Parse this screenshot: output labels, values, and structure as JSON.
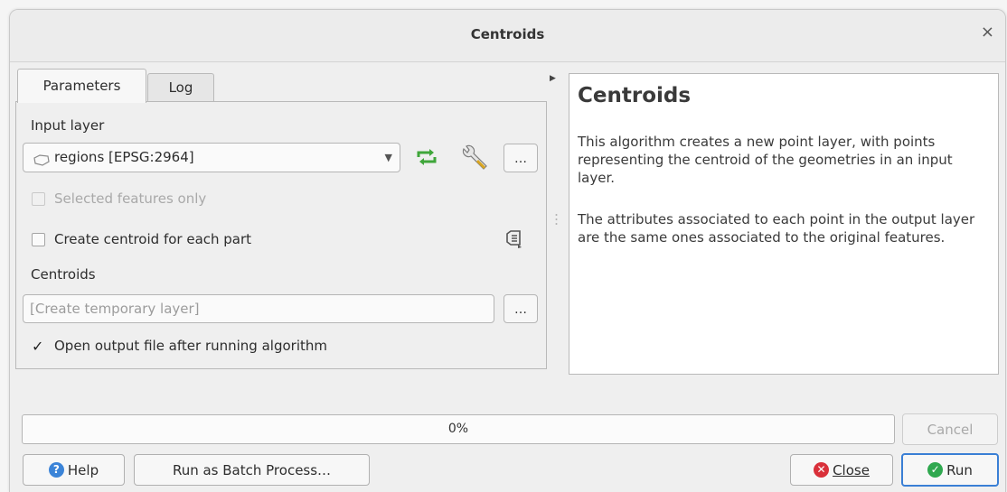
{
  "window": {
    "title": "Centroids",
    "close_glyph": "×"
  },
  "tabs": [
    {
      "label": "Parameters",
      "active": true
    },
    {
      "label": "Log",
      "active": false
    }
  ],
  "params": {
    "input_layer_label": "Input layer",
    "input_layer_value": "regions [EPSG:2964]",
    "dots": "…",
    "selected_only_label": "Selected features only",
    "selected_only_checked": false,
    "per_part_label": "Create centroid for each part",
    "per_part_checked": false,
    "centroids_label": "Centroids",
    "centroids_placeholder": "[Create temporary layer]",
    "open_output_label": "Open output file after running algorithm",
    "open_output_checked": true,
    "checkmark": "✓"
  },
  "help": {
    "title": "Centroids",
    "para1": "This algorithm creates a new point layer, with points representing the centroid of the geometries in an input layer.",
    "para2": "The attributes associated to each point in the output layer are the same ones associated to the original features."
  },
  "progress": {
    "value": 0,
    "text": "0%"
  },
  "buttons": {
    "cancel": "Cancel",
    "help": "Help",
    "batch": "Run as Batch Process…",
    "close": "Close",
    "run": "Run"
  },
  "icons": {
    "layer": "polygon-layer-icon",
    "refresh": "iterate-icon",
    "settings": "wrench-icon",
    "data_defined": "data-defined-override-icon",
    "help": "question-icon",
    "close": "close-circle-icon",
    "run": "check-circle-icon"
  },
  "colors": {
    "accent": "#3a7fd5",
    "refresh_green": "#3fa63a",
    "close_red": "#d9303a",
    "run_green": "#2fa84f",
    "help_blue": "#3b84d8"
  }
}
